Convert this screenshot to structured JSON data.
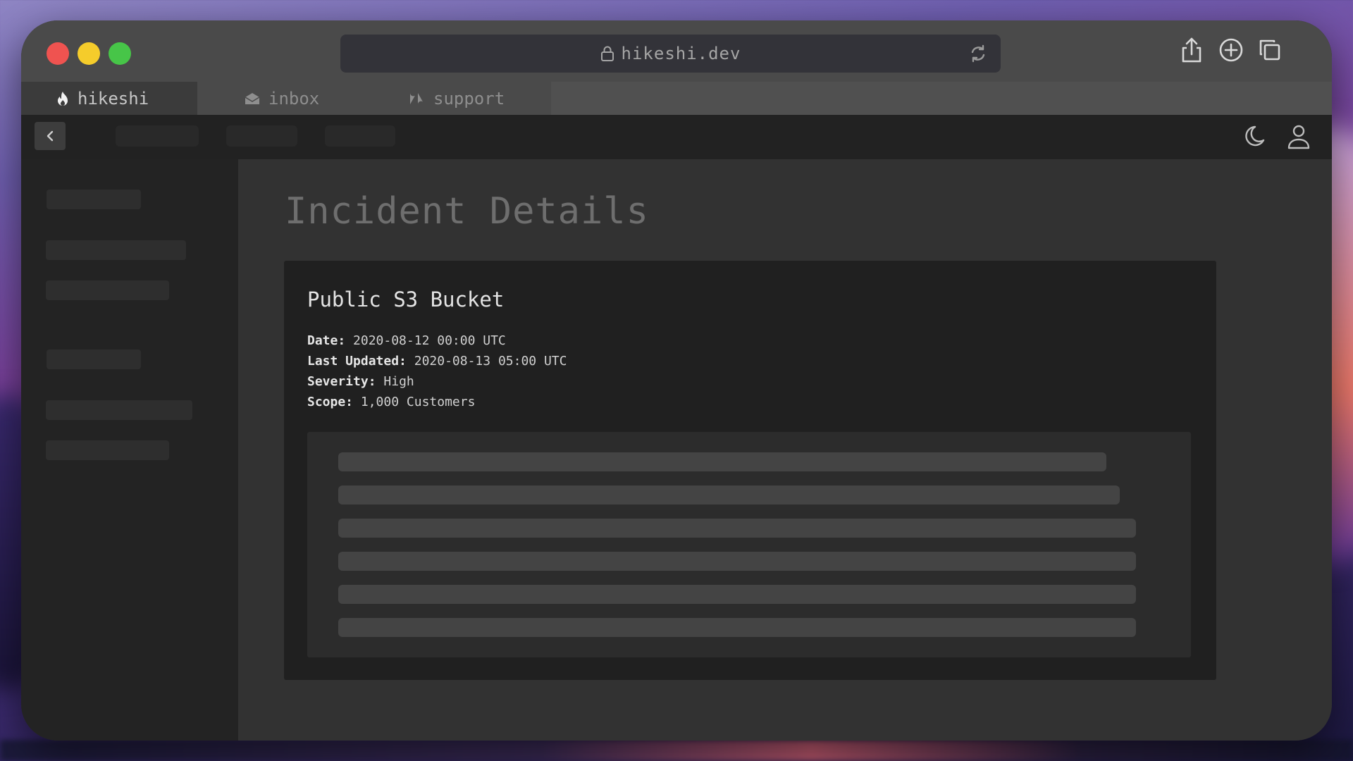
{
  "browser": {
    "url": "hikeshi.dev",
    "tabs": [
      {
        "label": "hikeshi",
        "icon": "flame-icon",
        "active": true
      },
      {
        "label": "inbox",
        "icon": "envelope-icon",
        "active": false
      },
      {
        "label": "support",
        "icon": "zendesk-icon",
        "active": false
      }
    ],
    "toolbar_icons": [
      "share-icon",
      "new-tab-icon",
      "tabs-overview-icon"
    ]
  },
  "app": {
    "header_icons": [
      "moon-icon",
      "user-icon"
    ]
  },
  "page": {
    "title": "Incident Details",
    "incident": {
      "title": "Public S3 Bucket",
      "fields": [
        {
          "label": "Date:",
          "value": "2020-08-12 00:00 UTC"
        },
        {
          "label": "Last Updated:",
          "value": "2020-08-13 05:00 UTC"
        },
        {
          "label": "Severity:",
          "value": "High"
        },
        {
          "label": "Scope:",
          "value": "1,000 Customers"
        }
      ]
    }
  },
  "colors": {
    "close": "#ef5350",
    "minimize": "#f5cc2b",
    "maximize": "#47c548"
  }
}
